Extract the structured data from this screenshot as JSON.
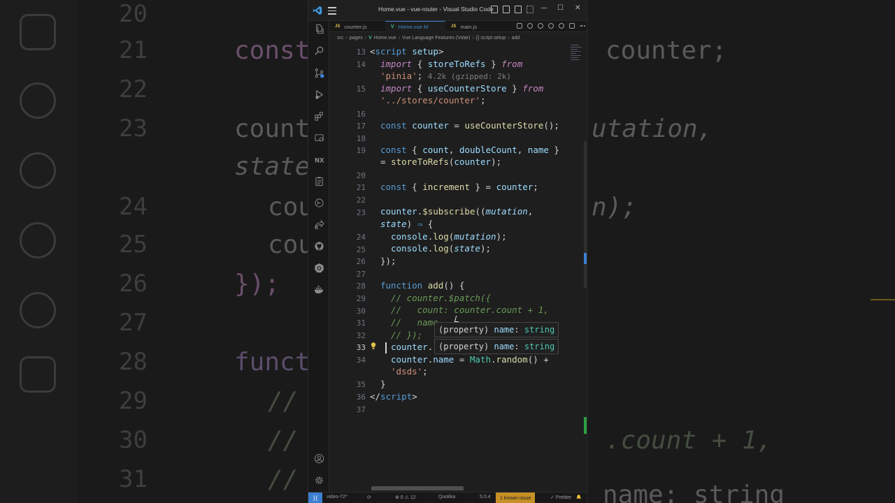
{
  "background": {
    "line_numbers": [
      "20",
      "21",
      "22",
      "23",
      "24",
      "25",
      "26",
      "27",
      "28",
      "29",
      "30",
      "31"
    ],
    "code_left": [
      "const",
      "counter",
      "state",
      "cou",
      "cou",
      "});",
      "funct",
      "//",
      "//",
      "//"
    ],
    "code_right": [
      "counter;",
      "utation,",
      "n);",
      ".count + 1,",
      "name: string"
    ]
  },
  "window": {
    "title": "Home.vue - vue-router - Visual Studio Code",
    "controls": {
      "minimize": "—",
      "maximize": "☐",
      "close": "✕"
    }
  },
  "tabs": [
    {
      "label": "counter.js",
      "lang": "JS",
      "active": false
    },
    {
      "label": "Home.vue  M",
      "lang": "V",
      "active": true
    },
    {
      "label": "main.js",
      "lang": "JS",
      "active": false
    }
  ],
  "breadcrumb": {
    "src": "src",
    "pages": "pages",
    "file_icon": "V",
    "file": "Home.vue",
    "features": "Vue Language Features (Volar)",
    "scope": "{} script setup",
    "symbol": "add"
  },
  "editor": {
    "line_numbers": {
      "l13": "13",
      "l14": "14",
      "l15": "15",
      "l16": "16",
      "l17": "17",
      "l18": "18",
      "l19": "19",
      "l20": "20",
      "l21": "21",
      "l22": "22",
      "l23": "23",
      "l24": "24",
      "l25": "25",
      "l26": "26",
      "l27": "27",
      "l28": "28",
      "l29": "29",
      "l30": "30",
      "l31": "31",
      "l32": "32",
      "l33": "33",
      "l34": "34",
      "l35": "35",
      "l36": "36",
      "l37": "37"
    },
    "import_cost": "4.2k (gzipped: 2k)",
    "hover_1": {
      "kind": "(property)",
      "name": "name",
      "type": "string"
    },
    "hover_2": {
      "kind": "(property)",
      "name": "name",
      "type": "string"
    }
  },
  "statusbar": {
    "branch": "video-72*",
    "sync": "⟳",
    "problems": "⊗ 0 ⚠ 12",
    "quokka": "Quokka",
    "version": "5.0.4",
    "issue": "1 known issue",
    "prettier": "✓ Prettier",
    "bell": "🔔"
  },
  "colors": {
    "accent_blue": "#3c7fd1",
    "issue_yellow": "#c69026",
    "keyword_purple": "#c586c0",
    "function_yellow": "#dcdcaa",
    "string_orange": "#ce9178",
    "variable_blue": "#9cdcfe",
    "comment_green": "#6a9955"
  },
  "icons": [
    "vscode-logo-icon",
    "menu-icon",
    "explorer-icon",
    "search-icon",
    "source-control-icon",
    "run-debug-icon",
    "extensions-icon",
    "remote-explorer-icon",
    "nx-icon",
    "clipboard-icon",
    "timeline-icon",
    "share-icon",
    "github-icon",
    "kubernetes-icon",
    "docker-icon",
    "account-icon",
    "gear-icon",
    "lightbulb-icon"
  ]
}
